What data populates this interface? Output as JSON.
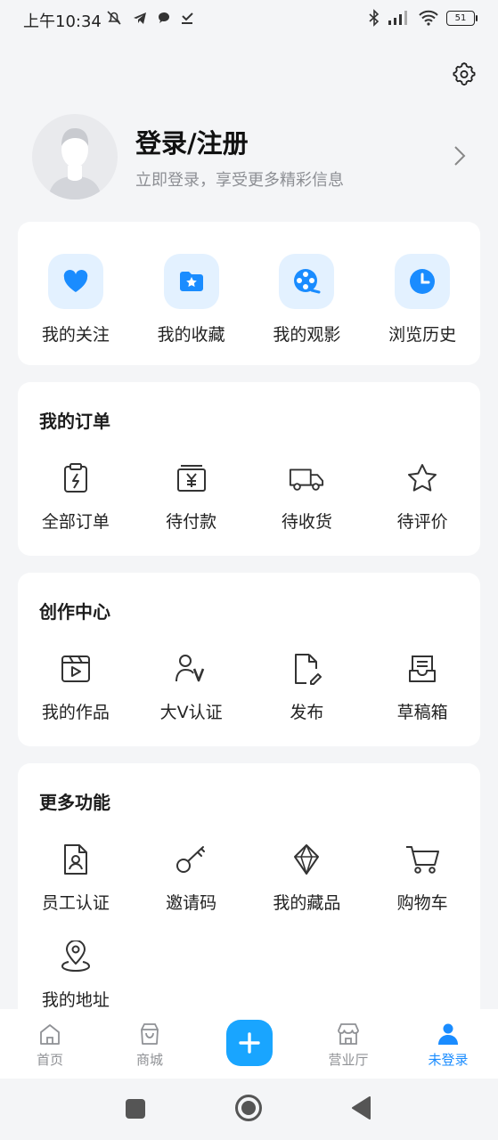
{
  "status_bar": {
    "time": "上午10:34",
    "battery": "51"
  },
  "profile": {
    "title": "登录/注册",
    "subtitle": "立即登录，享受更多精彩信息"
  },
  "quick_actions": [
    {
      "label": "我的关注",
      "icon": "heart-icon"
    },
    {
      "label": "我的收藏",
      "icon": "star-folder-icon"
    },
    {
      "label": "我的观影",
      "icon": "film-reel-icon"
    },
    {
      "label": "浏览历史",
      "icon": "clock-icon"
    }
  ],
  "orders": {
    "title": "我的订单",
    "items": [
      {
        "label": "全部订单",
        "icon": "clipboard-icon"
      },
      {
        "label": "待付款",
        "icon": "yuan-wallet-icon"
      },
      {
        "label": "待收货",
        "icon": "truck-icon"
      },
      {
        "label": "待评价",
        "icon": "star-outline-icon"
      }
    ]
  },
  "creator": {
    "title": "创作中心",
    "items": [
      {
        "label": "我的作品",
        "icon": "video-icon"
      },
      {
        "label": "大V认证",
        "icon": "user-v-icon"
      },
      {
        "label": "发布",
        "icon": "document-edit-icon"
      },
      {
        "label": "草稿箱",
        "icon": "inbox-icon"
      }
    ]
  },
  "more": {
    "title": "更多功能",
    "items": [
      {
        "label": "员工认证",
        "icon": "badge-icon"
      },
      {
        "label": "邀请码",
        "icon": "key-icon"
      },
      {
        "label": "我的藏品",
        "icon": "diamond-icon"
      },
      {
        "label": "购物车",
        "icon": "cart-icon"
      },
      {
        "label": "我的地址",
        "icon": "location-pin-icon"
      }
    ]
  },
  "tabbar": {
    "tabs": [
      {
        "label": "首页",
        "icon": "home-icon"
      },
      {
        "label": "商城",
        "icon": "shopping-bag-icon"
      },
      {
        "label": "营业厅",
        "icon": "store-icon"
      },
      {
        "label": "未登录",
        "icon": "person-icon"
      }
    ],
    "active_color": "#1a8cff"
  },
  "colors": {
    "accent": "#19a5ff",
    "icon_bg": "#e3f1ff"
  }
}
